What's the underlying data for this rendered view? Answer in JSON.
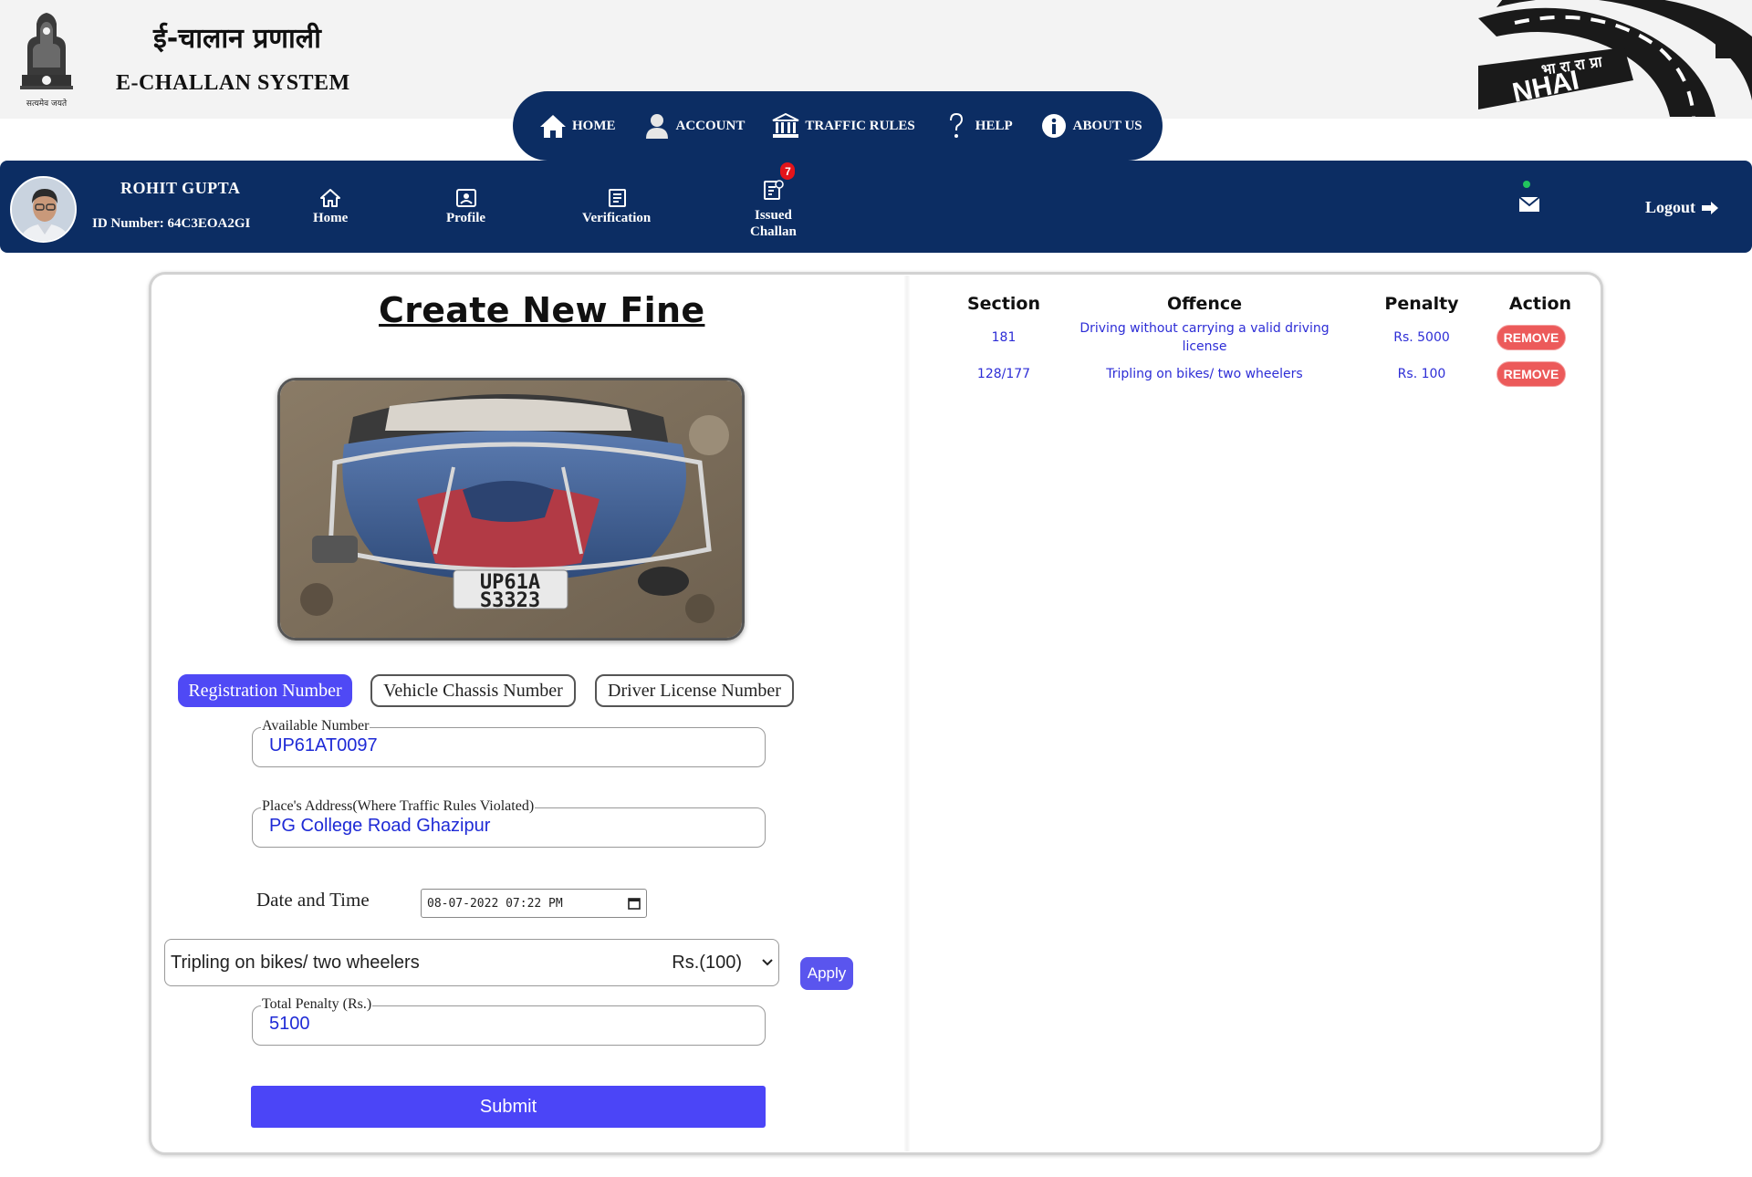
{
  "header": {
    "title_hindi": "ई-चालान प्रणाली",
    "title_english": "E-CHALLAN SYSTEM",
    "emblem_motto": "सत्यमेव जयते",
    "nhai_hindi": "भा रा रा प्रा",
    "nhai_text": "NHAI"
  },
  "main_nav": [
    {
      "label": "HOME",
      "icon": "home-icon"
    },
    {
      "label": "ACCOUNT",
      "icon": "user-icon"
    },
    {
      "label": "TRAFFIC RULES",
      "icon": "bank-icon"
    },
    {
      "label": "HELP",
      "icon": "question-icon"
    },
    {
      "label": "ABOUT US",
      "icon": "info-icon"
    }
  ],
  "user_bar": {
    "name": "ROHIT GUPTA",
    "id_line": "ID Number: 64C3EOA2GI",
    "items": [
      {
        "label": "Home",
        "icon": "home-outline-icon"
      },
      {
        "label": "Profile",
        "icon": "profile-card-icon"
      },
      {
        "label": "Verification",
        "icon": "document-icon"
      },
      {
        "label": "Issued\nChallan",
        "label_line1": "Issued",
        "label_line2": "Challan",
        "icon": "issued-challan-icon",
        "badge": "7"
      }
    ],
    "mail_icon": "mail-icon",
    "logout_label": "Logout"
  },
  "form": {
    "title": "Create New Fine",
    "plate_line1": "UP61A",
    "plate_line2": "S3323",
    "tabs": [
      {
        "label": "Registration Number",
        "active": true
      },
      {
        "label": "Vehicle Chassis Number",
        "active": false
      },
      {
        "label": "Driver License Number",
        "active": false
      }
    ],
    "available_number": {
      "legend": "Available Number",
      "value": "UP61AT0097"
    },
    "place": {
      "legend": "Place's Address(Where Traffic Rules Violated)",
      "value": "PG College Road Ghazipur"
    },
    "datetime": {
      "label": "Date and Time",
      "value": "08-07-2022 07:22 PM"
    },
    "offence_select": {
      "text": "Tripling on bikes/ two wheelers",
      "price": "Rs.(100)"
    },
    "apply_label": "Apply",
    "total_penalty": {
      "legend": "Total Penalty (Rs.)",
      "value": "5100"
    },
    "submit_label": "Submit"
  },
  "fines_table": {
    "headers": [
      "Section",
      "Offence",
      "Penalty",
      "Action"
    ],
    "rows": [
      {
        "section": "181",
        "offence_line1": "Driving without carrying a valid driving",
        "offence_line2": "license",
        "penalty": "Rs. 5000",
        "action": "REMOVE"
      },
      {
        "section": "128/177",
        "offence_line1": "Tripling on bikes/ two wheelers",
        "offence_line2": "",
        "penalty": "Rs. 100",
        "action": "REMOVE"
      }
    ]
  },
  "colors": {
    "navy": "#0c2d63",
    "primary_button": "#4b45f7",
    "remove_button": "#ec5a5a",
    "table_text": "#2d2dd6",
    "badge": "#e3141b"
  }
}
